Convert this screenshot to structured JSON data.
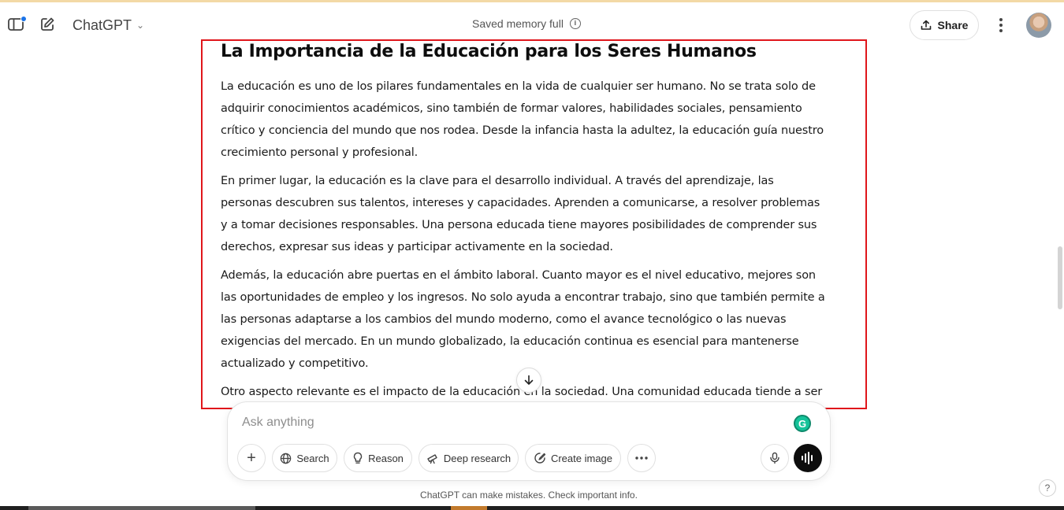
{
  "header": {
    "app_title": "ChatGPT",
    "memory_status": "Saved memory full",
    "share_label": "Share"
  },
  "icons": {
    "sidebar": "sidebar-toggle-icon",
    "new_chat": "edit-icon",
    "info": "info-icon",
    "share": "upload-icon",
    "more": "more-vertical-icon",
    "scroll_down": "arrow-down-icon"
  },
  "article": {
    "title": "La Importancia de la Educación para los Seres Humanos",
    "paragraphs": [
      "La educación es uno de los pilares fundamentales en la vida de cualquier ser humano. No se trata solo de adquirir conocimientos académicos, sino también de formar valores, habilidades sociales, pensamiento crítico y conciencia del mundo que nos rodea. Desde la infancia hasta la adultez, la educación guía nuestro crecimiento personal y profesional.",
      "En primer lugar, la educación es la clave para el desarrollo individual. A través del aprendizaje, las personas descubren sus talentos, intereses y capacidades. Aprenden a comunicarse, a resolver problemas y a tomar decisiones responsables. Una persona educada tiene mayores posibilidades de comprender sus derechos, expresar sus ideas y participar activamente en la sociedad.",
      "Además, la educación abre puertas en el ámbito laboral. Cuanto mayor es el nivel educativo, mejores son las oportunidades de empleo y los ingresos. No solo ayuda a encontrar trabajo, sino que también permite a las personas adaptarse a los cambios del mundo moderno, como el avance tecnológico o las nuevas exigencias del mercado. En un mundo globalizado, la educación continua es esencial para mantenerse actualizado y competitivo.",
      "Otro aspecto relevante es el impacto de la educación en la sociedad. Una comunidad educada tiende a ser"
    ]
  },
  "composer": {
    "placeholder": "Ask anything",
    "tools": {
      "search": "Search",
      "reason": "Reason",
      "deep_research": "Deep research",
      "create_image": "Create image"
    }
  },
  "footer": {
    "disclaimer": "ChatGPT can make mistakes. Check important info.",
    "help": "?"
  },
  "colors": {
    "highlight_border": "#e0161b",
    "notification_dot": "#1a73e8",
    "grammarly": "#15c39a"
  }
}
